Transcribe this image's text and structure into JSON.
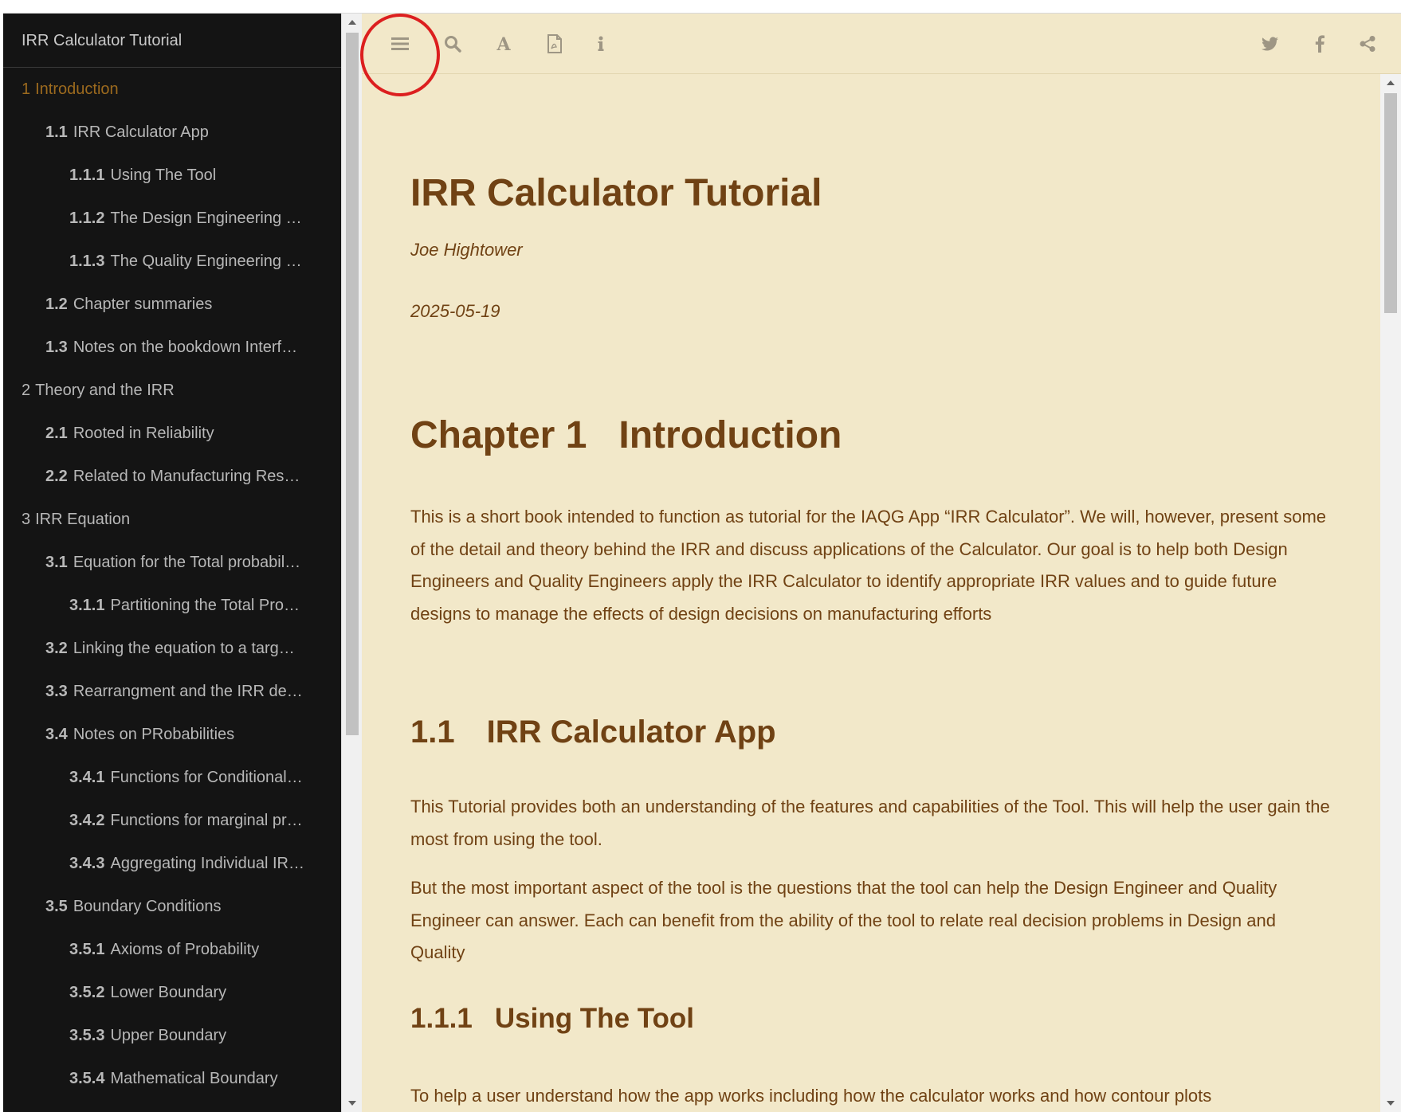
{
  "sidebar": {
    "title": "IRR Calculator Tutorial",
    "items": [
      {
        "num": "1",
        "label": "Introduction",
        "level": 1,
        "active": true
      },
      {
        "num": "1.1",
        "label": "IRR Calculator App",
        "level": 2
      },
      {
        "num": "1.1.1",
        "label": "Using The Tool",
        "level": 3
      },
      {
        "num": "1.1.2",
        "label": "The Design Engineering …",
        "level": 3
      },
      {
        "num": "1.1.3",
        "label": "The Quality Engineering …",
        "level": 3
      },
      {
        "num": "1.2",
        "label": "Chapter summaries",
        "level": 2
      },
      {
        "num": "1.3",
        "label": "Notes on the bookdown Interf…",
        "level": 2
      },
      {
        "num": "2",
        "label": "Theory and the IRR",
        "level": 1
      },
      {
        "num": "2.1",
        "label": "Rooted in Reliability",
        "level": 2
      },
      {
        "num": "2.2",
        "label": "Related to Manufacturing Res…",
        "level": 2
      },
      {
        "num": "3",
        "label": "IRR Equation",
        "level": 1
      },
      {
        "num": "3.1",
        "label": "Equation for the Total probabil…",
        "level": 2
      },
      {
        "num": "3.1.1",
        "label": "Partitioning the Total Pro…",
        "level": 3
      },
      {
        "num": "3.2",
        "label": "Linking the equation to a targ…",
        "level": 2
      },
      {
        "num": "3.3",
        "label": "Rearrangment and the IRR de…",
        "level": 2
      },
      {
        "num": "3.4",
        "label": "Notes on PRobabilities",
        "level": 2
      },
      {
        "num": "3.4.1",
        "label": "Functions for Conditional…",
        "level": 3
      },
      {
        "num": "3.4.2",
        "label": "Functions for marginal pr…",
        "level": 3
      },
      {
        "num": "3.4.3",
        "label": "Aggregating Individual IR…",
        "level": 3
      },
      {
        "num": "3.5",
        "label": "Boundary Conditions",
        "level": 2
      },
      {
        "num": "3.5.1",
        "label": "Axioms of Probability",
        "level": 3
      },
      {
        "num": "3.5.2",
        "label": "Lower Boundary",
        "level": 3
      },
      {
        "num": "3.5.3",
        "label": "Upper Boundary",
        "level": 3
      },
      {
        "num": "3.5.4",
        "label": "Mathematical Boundary",
        "level": 3
      }
    ]
  },
  "toolbar": {
    "left_icons": [
      "menu-icon",
      "search-icon",
      "font-icon",
      "pdf-icon",
      "info-icon"
    ],
    "right_icons": [
      "twitter-icon",
      "facebook-icon",
      "share-icon"
    ]
  },
  "content": {
    "title": "IRR Calculator Tutorial",
    "author": "Joe Hightower",
    "date": "2025-05-19",
    "chapter_num": "Chapter 1",
    "chapter_title": "Introduction",
    "intro_paragraph": "This is a short book intended to function as tutorial for the IAQG App “IRR Calculator”. We will, however, present some of the detail and theory behind the IRR and discuss applications of the Calculator. Our goal is to help both Design Engineers and Quality Engineers apply the IRR Calculator to identify appropriate IRR values and to guide future designs to manage the effects of design decisions on manufacturing efforts",
    "section_1_1_num": "1.1",
    "section_1_1_title": "IRR Calculator App",
    "section_1_1_p1": "This Tutorial provides both an understanding of the features and capabilities of the Tool. This will help the user gain the most from using the tool.",
    "section_1_1_p2": "But the most important aspect of the tool is the questions that the tool can help the Design Engineer and Quality Engineer can answer. Each can benefit from the ability of the tool to relate real decision problems in Design and Quality",
    "section_1_1_1_num": "1.1.1",
    "section_1_1_1_title": "Using The Tool",
    "section_1_1_1_p1": "To help a user understand how the app works including how the calculator works and how contour plots"
  },
  "colors": {
    "sidebar_bg": "#141414",
    "main_bg": "#f2e8c9",
    "text_brown": "#704214",
    "active_toc": "#9c6a1e",
    "highlight_circle": "#dc1f1f"
  }
}
